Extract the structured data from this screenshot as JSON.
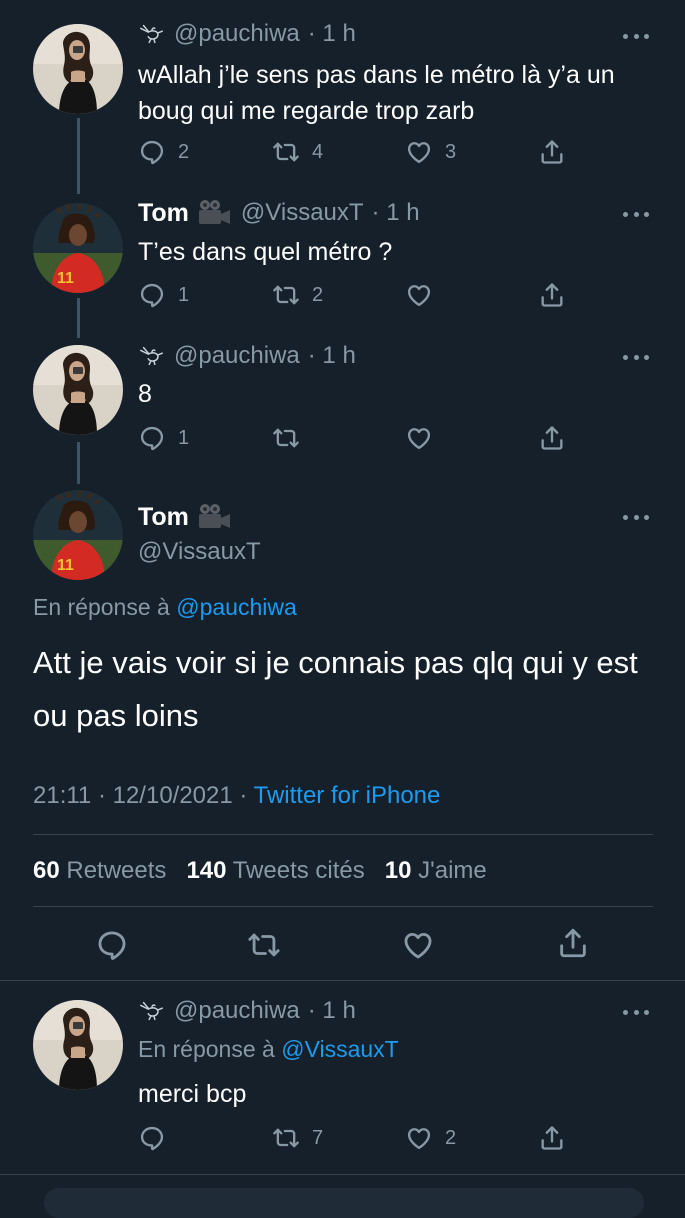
{
  "tweets": [
    {
      "handle": "@pauchiwa",
      "time": "· 1 h",
      "text": "wAllah j’le sens pas dans le métro là y’a un boug qui me regarde trop zarb",
      "replies": "2",
      "retweets": "4",
      "likes": "3"
    },
    {
      "name": "Tom",
      "handle": "@VissauxT",
      "time": "· 1 h",
      "text": "T’es dans quel métro ?",
      "replies": "1",
      "retweets": "2",
      "likes": ""
    },
    {
      "handle": "@pauchiwa",
      "time": "· 1 h",
      "text": "8",
      "replies": "1",
      "retweets": "",
      "likes": ""
    }
  ],
  "main_tweet": {
    "name": "Tom",
    "handle": "@VissauxT",
    "reply_prefix": "En réponse à",
    "reply_to": "@pauchiwa",
    "text": "Att je vais voir si je connais pas qlq qui y est ou pas loins",
    "timestamp": "21:11 · 12/10/2021 ·",
    "source": "Twitter for iPhone",
    "retweets_count": "60",
    "retweets_label": "Retweets",
    "quotes_count": "140",
    "quotes_label": "Tweets cités",
    "likes_count": "10",
    "likes_label": "J'aime"
  },
  "reply_tweet": {
    "handle": "@pauchiwa",
    "time": "· 1 h",
    "reply_prefix": "En réponse à",
    "reply_to": "@VissauxT",
    "text": "merci bcp",
    "replies": "",
    "retweets": "7",
    "likes": "2"
  },
  "colors": {
    "background": "#15202b",
    "accent": "#1d9bf0",
    "muted": "#8899a6",
    "thread_line": "#3d5466"
  },
  "icons": [
    "bird-doodle-icon",
    "camera-emoji-icon",
    "more-icon",
    "reply-icon",
    "retweet-icon",
    "like-icon",
    "share-icon"
  ]
}
